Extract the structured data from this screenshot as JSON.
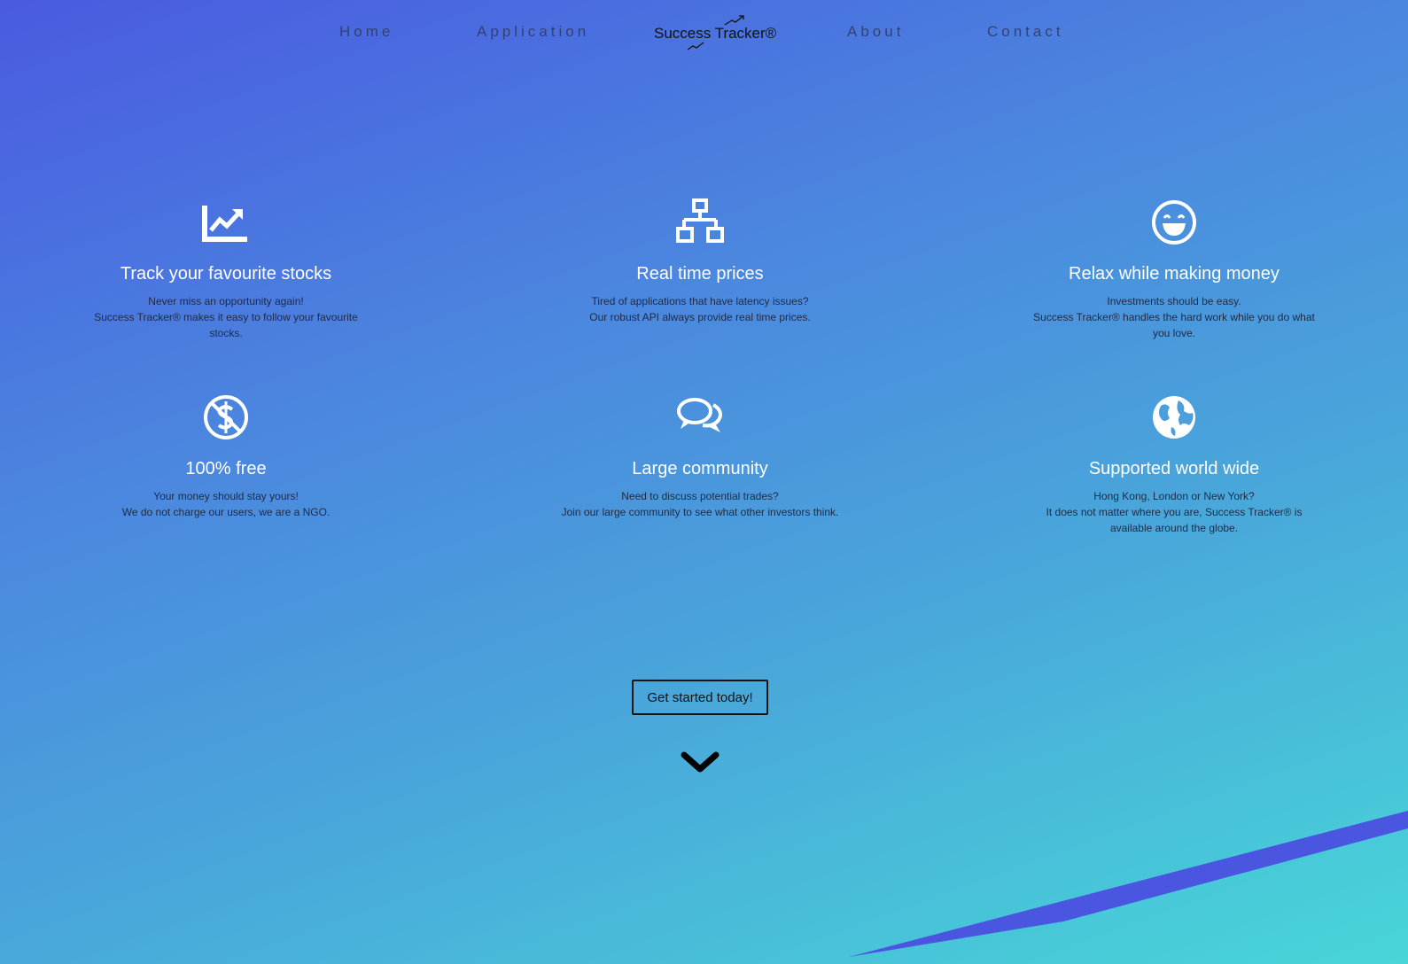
{
  "nav": {
    "home": "Home",
    "application": "Application",
    "logo_text": "Success Tracker®",
    "about": "About",
    "contact": "Contact"
  },
  "features": [
    {
      "icon": "chart-line-icon",
      "title": "Track your favourite stocks",
      "lines": [
        "Never miss an opportunity again!",
        "Success Tracker® makes it easy to follow your favourite stocks."
      ]
    },
    {
      "icon": "network-icon",
      "title": "Real time prices",
      "lines": [
        "Tired of applications that have latency issues?",
        "Our robust API always provide real time prices."
      ]
    },
    {
      "icon": "grin-icon",
      "title": "Relax while making money",
      "lines": [
        "Investments should be easy.",
        "Success Tracker® handles the hard work while you do what you love."
      ]
    },
    {
      "icon": "no-dollar-icon",
      "title": "100% free",
      "lines": [
        "Your money should stay yours!",
        "We do not charge our users, we are a NGO."
      ]
    },
    {
      "icon": "comments-icon",
      "title": "Large community",
      "lines": [
        "Need to discuss potential trades?",
        "Join our large community to see what other investors think."
      ]
    },
    {
      "icon": "globe-icon",
      "title": "Supported world wide",
      "lines": [
        "Hong Kong, London or New York?",
        "It does not matter where you are, Success Tracker® is available around the globe."
      ]
    }
  ],
  "cta": {
    "label": "Get started today!"
  },
  "colors": {
    "accent_stripe": "#4a55e0",
    "text_dark": "#1f2a44"
  }
}
